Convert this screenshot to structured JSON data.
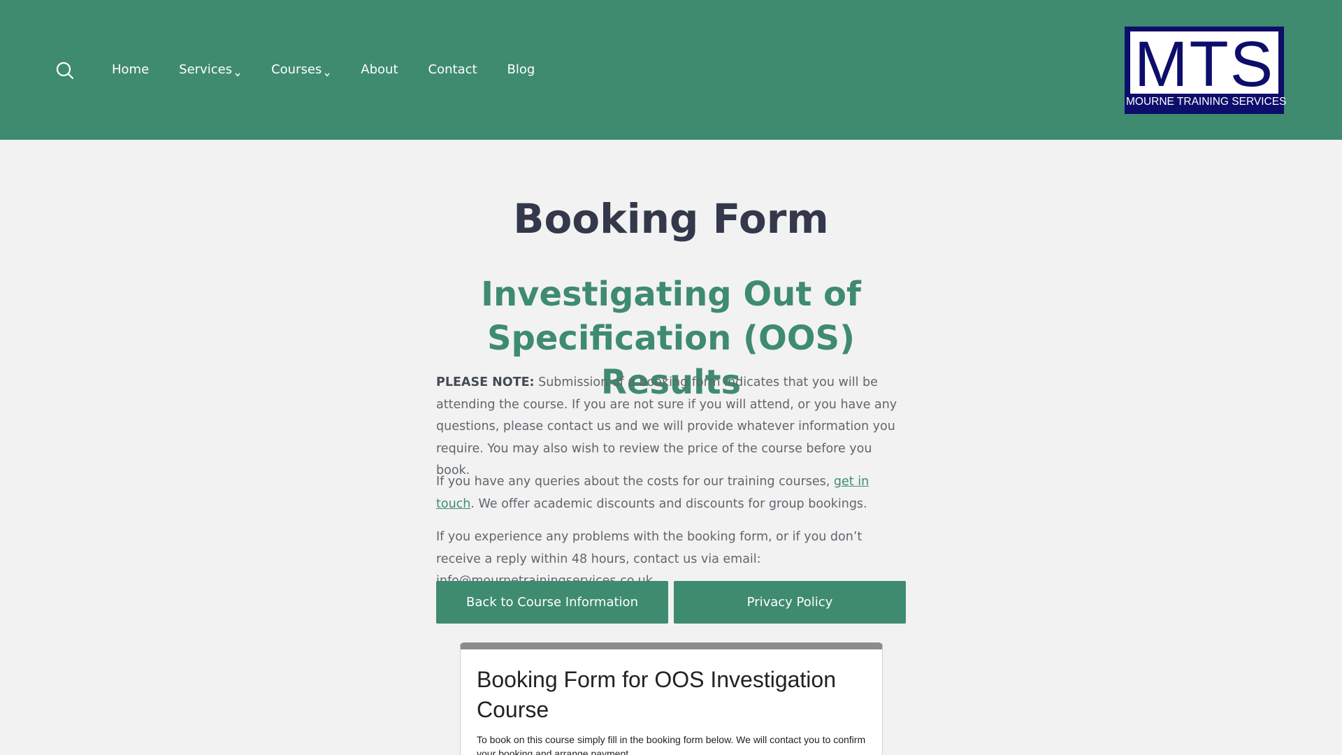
{
  "header": {
    "nav": [
      {
        "label": "Home",
        "has_dropdown": false
      },
      {
        "label": "Services",
        "has_dropdown": true
      },
      {
        "label": "Courses",
        "has_dropdown": true
      },
      {
        "label": "About",
        "has_dropdown": false
      },
      {
        "label": "Contact",
        "has_dropdown": false
      },
      {
        "label": "Blog",
        "has_dropdown": false
      }
    ],
    "logo": {
      "text": "MTS",
      "subtitle": "MOURNE TRAINING SERVICES"
    },
    "background_color": "#3f8b70",
    "search_icon": "search-icon"
  },
  "main": {
    "page_title": "Booking Form",
    "course_title": "Investigating Out of Specification (OOS) Results",
    "note": {
      "label": "PLEASE NOTE:",
      "text": " Submission of a booking form indicates that you will be attending the course. If you are not sure if you will attend, or you have any questions, please contact us and we will provide whatever information you require. You may also wish to review the price of the course before you book."
    },
    "queries": {
      "before": "If you have any queries about the costs for our training courses, ",
      "link": "get in touch",
      "after": ". We offer academic discounts and discounts for group bookings."
    },
    "problems_text": "If you experience any problems with the booking form, or if you don’t receive a reply within 48 hours, contact us via email: info@mournetrainingservices.co.uk",
    "buttons": {
      "back": "Back to Course Information",
      "privacy": "Privacy Policy"
    },
    "form": {
      "title": "Booking Form for OOS Investigation Course",
      "description": "To book on this course simply fill in the booking form below. We will contact you to confirm your booking and arrange payment."
    }
  },
  "colors": {
    "accent": "#3f8b70",
    "title": "#33384a",
    "logo_navy": "#0d0d6b"
  }
}
